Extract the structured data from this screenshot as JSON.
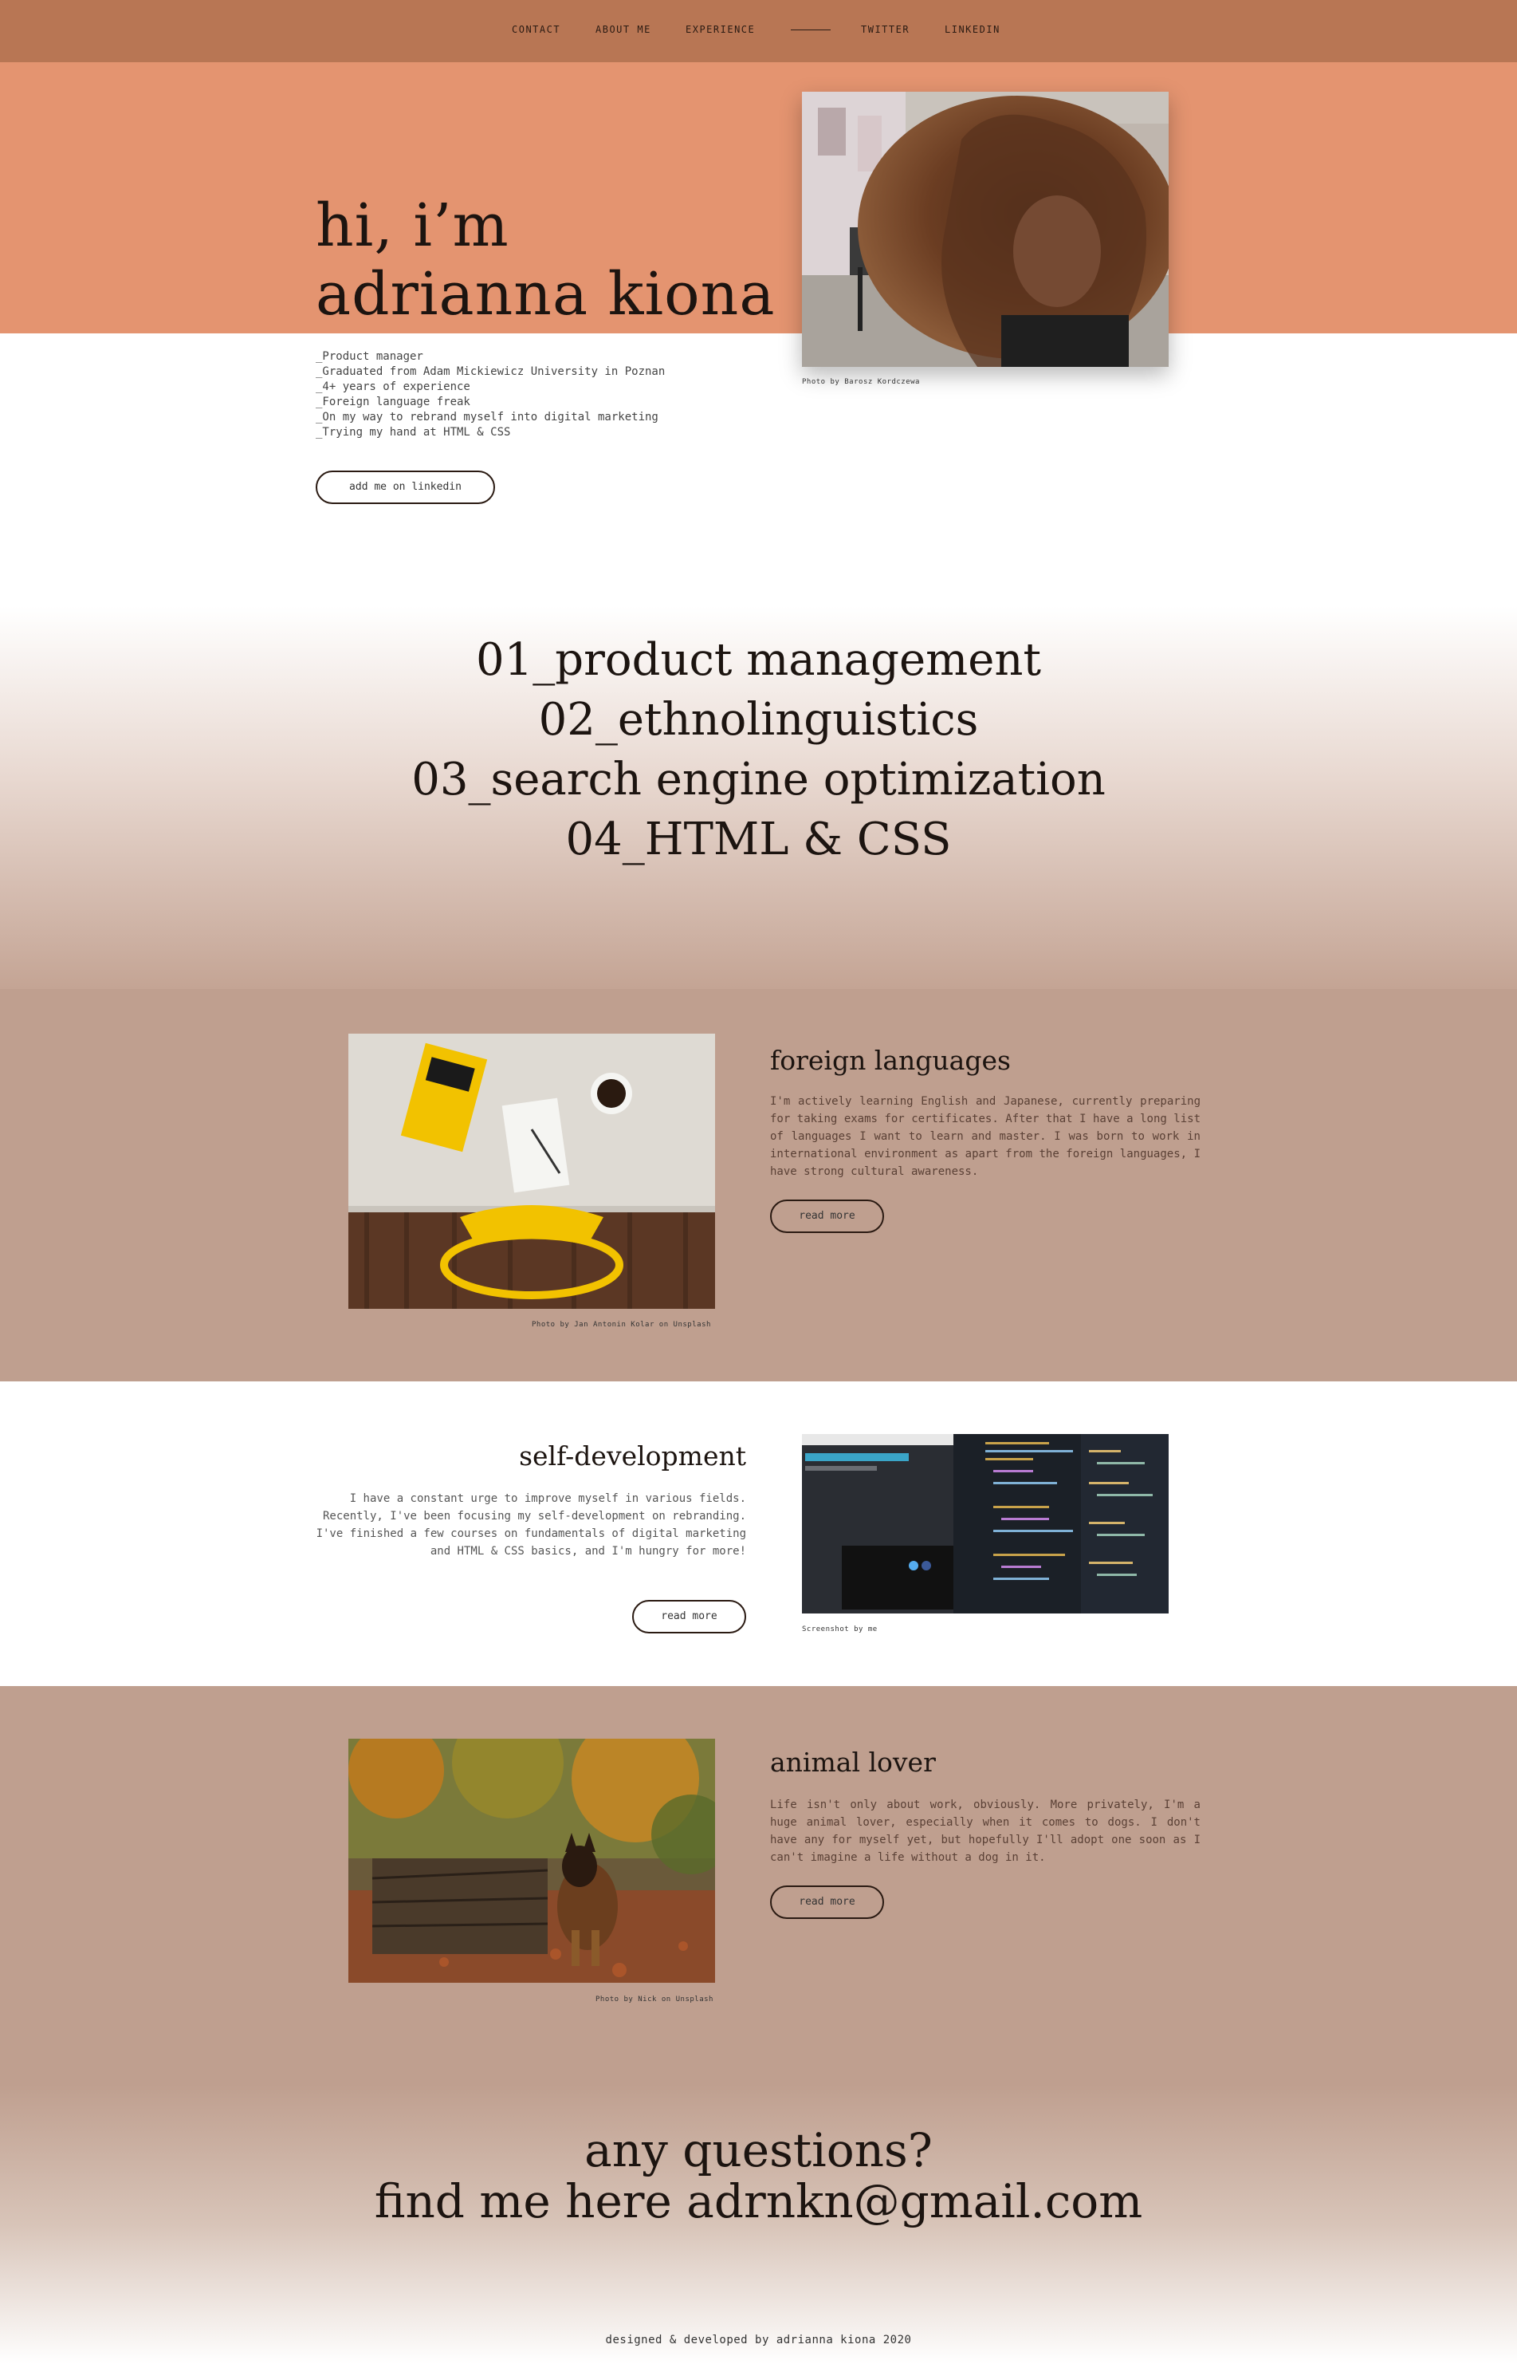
{
  "nav": {
    "items": [
      "CONTACT",
      "ABOUT ME",
      "EXPERIENCE"
    ],
    "right_items": [
      "TWITTER",
      "LINKEDIN"
    ]
  },
  "hero": {
    "title_line1": "hi, i’m",
    "title_line2": "adrianna kiona",
    "photo_credit": "Photo by Barosz Kordczewa",
    "bio": [
      "_Product manager",
      "_Graduated from Adam Mickiewicz University in Poznan",
      "_4+ years of experience",
      "_Foreign language freak",
      "_On my way to rebrand myself into digital marketing",
      "_Trying my hand at HTML & CSS"
    ],
    "cta_label": "add me on linkedin"
  },
  "skills": [
    "01_product management",
    "02_ethnolinguistics",
    "03_search engine optimization",
    "04_HTML & CSS"
  ],
  "sections": {
    "languages": {
      "heading": "foreign languages",
      "text": "I'm actively learning English and Japanese, currently preparing for taking exams for certificates. After that I have a long list of languages I want to learn and master. I was born to work in international environment as apart from the foreign languages, I have strong cultural awareness.",
      "button": "read more",
      "photo_credit": "Photo by Jan Antonin Kolar on Unsplash"
    },
    "selfdev": {
      "heading": "self-development",
      "text": "I have a constant urge to improve myself in various fields. Recently, I've been focusing my self-development on rebranding. I've finished a few courses on fundamentals of digital marketing and HTML & CSS basics, and I'm hungry for more!",
      "button": "read more",
      "photo_credit": "Screenshot by me"
    },
    "animal": {
      "heading": "animal lover",
      "text": "Life isn't only about work, obviously. More privately, I'm a huge animal lover, especially when it comes to dogs. I don't have any for myself yet, but hopefully I'll adopt one soon as I can't imagine a life without a dog in it.",
      "button": "read more",
      "photo_credit": "Photo by Nick on Unsplash"
    }
  },
  "contact": {
    "line1": "any questions?",
    "line2": "find me here adrnkn@gmail.com"
  },
  "footer": "designed & developed by adrianna kiona 2020",
  "colors": {
    "nav": "#b87654",
    "hero": "#e49470",
    "section": "#bf9f8f"
  }
}
